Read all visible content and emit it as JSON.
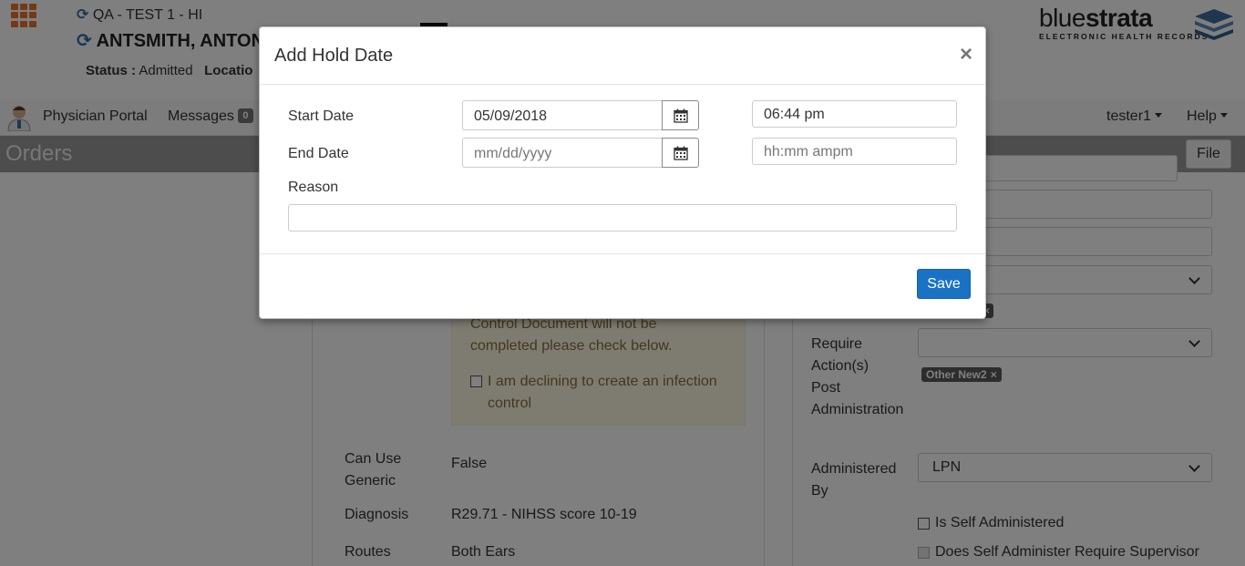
{
  "header": {
    "environment": "QA - TEST 1 - HI",
    "patient_name": "ANTSMITH, ANTON",
    "status_label": "Status :",
    "status_value": "Admitted",
    "location_label": "Locatio",
    "logo_light": "blue",
    "logo_bold": "strata",
    "logo_sub": "ELECTRONIC HEALTH RECORDS"
  },
  "navbar": {
    "portal": "Physician Portal",
    "messages": "Messages",
    "messages_count": "0",
    "user": "tester1",
    "help": "Help"
  },
  "page": {
    "title": "Orders",
    "file_button": "File"
  },
  "order_detail": {
    "warning_text": "Control Document will not be completed please check below.",
    "decline_label": "I am declining to create an infection control",
    "can_use_generic_label": "Can Use Generic",
    "can_use_generic_value": "False",
    "diagnosis_label": "Diagnosis",
    "diagnosis_value": "R29.71 - NIHSS score 10-19",
    "routes_label": "Routes",
    "routes_value": "Both Ears",
    "require_action_label": "Require Action(s) Post Administration",
    "tag_other": "Other New2",
    "tag_remove": "×",
    "administered_by_label": "Administered By",
    "administered_by_value": "LPN",
    "self_administered_label": "Is Self Administered",
    "self_admin_supervisor_label": "Does Self Administer Require Supervisor"
  },
  "modal": {
    "title": "Add Hold Date",
    "close": "×",
    "start_date_label": "Start Date",
    "start_date_value": "05/09/2018",
    "start_time_value": "06:44 pm",
    "end_date_label": "End Date",
    "end_date_placeholder": "mm/dd/yyyy",
    "end_time_placeholder": "hh:mm ampm",
    "reason_label": "Reason",
    "reason_value": "",
    "save_label": "Save"
  }
}
